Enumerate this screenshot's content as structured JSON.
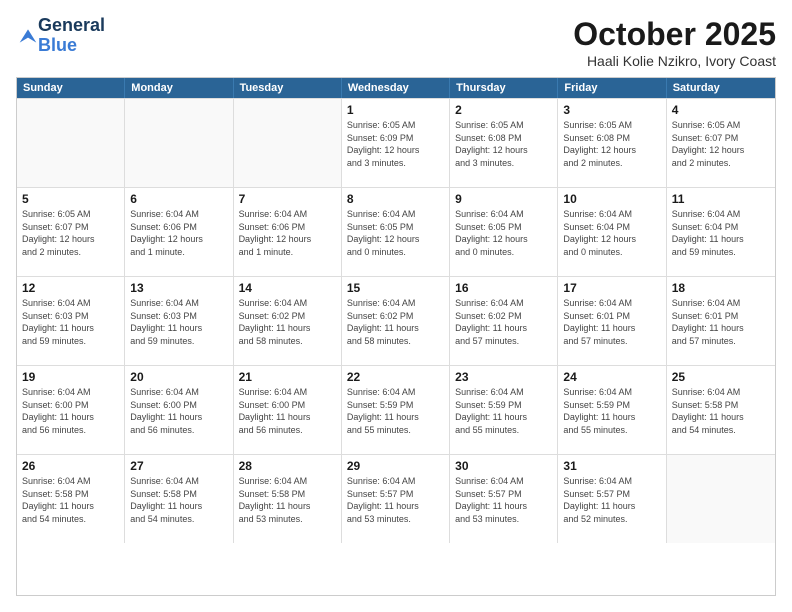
{
  "logo": {
    "line1": "General",
    "line2": "Blue"
  },
  "title": "October 2025",
  "location": "Haali Kolie Nzikro, Ivory Coast",
  "days_of_week": [
    "Sunday",
    "Monday",
    "Tuesday",
    "Wednesday",
    "Thursday",
    "Friday",
    "Saturday"
  ],
  "weeks": [
    [
      {
        "day": "",
        "info": ""
      },
      {
        "day": "",
        "info": ""
      },
      {
        "day": "",
        "info": ""
      },
      {
        "day": "1",
        "info": "Sunrise: 6:05 AM\nSunset: 6:09 PM\nDaylight: 12 hours\nand 3 minutes."
      },
      {
        "day": "2",
        "info": "Sunrise: 6:05 AM\nSunset: 6:08 PM\nDaylight: 12 hours\nand 3 minutes."
      },
      {
        "day": "3",
        "info": "Sunrise: 6:05 AM\nSunset: 6:08 PM\nDaylight: 12 hours\nand 2 minutes."
      },
      {
        "day": "4",
        "info": "Sunrise: 6:05 AM\nSunset: 6:07 PM\nDaylight: 12 hours\nand 2 minutes."
      }
    ],
    [
      {
        "day": "5",
        "info": "Sunrise: 6:05 AM\nSunset: 6:07 PM\nDaylight: 12 hours\nand 2 minutes."
      },
      {
        "day": "6",
        "info": "Sunrise: 6:04 AM\nSunset: 6:06 PM\nDaylight: 12 hours\nand 1 minute."
      },
      {
        "day": "7",
        "info": "Sunrise: 6:04 AM\nSunset: 6:06 PM\nDaylight: 12 hours\nand 1 minute."
      },
      {
        "day": "8",
        "info": "Sunrise: 6:04 AM\nSunset: 6:05 PM\nDaylight: 12 hours\nand 0 minutes."
      },
      {
        "day": "9",
        "info": "Sunrise: 6:04 AM\nSunset: 6:05 PM\nDaylight: 12 hours\nand 0 minutes."
      },
      {
        "day": "10",
        "info": "Sunrise: 6:04 AM\nSunset: 6:04 PM\nDaylight: 12 hours\nand 0 minutes."
      },
      {
        "day": "11",
        "info": "Sunrise: 6:04 AM\nSunset: 6:04 PM\nDaylight: 11 hours\nand 59 minutes."
      }
    ],
    [
      {
        "day": "12",
        "info": "Sunrise: 6:04 AM\nSunset: 6:03 PM\nDaylight: 11 hours\nand 59 minutes."
      },
      {
        "day": "13",
        "info": "Sunrise: 6:04 AM\nSunset: 6:03 PM\nDaylight: 11 hours\nand 59 minutes."
      },
      {
        "day": "14",
        "info": "Sunrise: 6:04 AM\nSunset: 6:02 PM\nDaylight: 11 hours\nand 58 minutes."
      },
      {
        "day": "15",
        "info": "Sunrise: 6:04 AM\nSunset: 6:02 PM\nDaylight: 11 hours\nand 58 minutes."
      },
      {
        "day": "16",
        "info": "Sunrise: 6:04 AM\nSunset: 6:02 PM\nDaylight: 11 hours\nand 57 minutes."
      },
      {
        "day": "17",
        "info": "Sunrise: 6:04 AM\nSunset: 6:01 PM\nDaylight: 11 hours\nand 57 minutes."
      },
      {
        "day": "18",
        "info": "Sunrise: 6:04 AM\nSunset: 6:01 PM\nDaylight: 11 hours\nand 57 minutes."
      }
    ],
    [
      {
        "day": "19",
        "info": "Sunrise: 6:04 AM\nSunset: 6:00 PM\nDaylight: 11 hours\nand 56 minutes."
      },
      {
        "day": "20",
        "info": "Sunrise: 6:04 AM\nSunset: 6:00 PM\nDaylight: 11 hours\nand 56 minutes."
      },
      {
        "day": "21",
        "info": "Sunrise: 6:04 AM\nSunset: 6:00 PM\nDaylight: 11 hours\nand 56 minutes."
      },
      {
        "day": "22",
        "info": "Sunrise: 6:04 AM\nSunset: 5:59 PM\nDaylight: 11 hours\nand 55 minutes."
      },
      {
        "day": "23",
        "info": "Sunrise: 6:04 AM\nSunset: 5:59 PM\nDaylight: 11 hours\nand 55 minutes."
      },
      {
        "day": "24",
        "info": "Sunrise: 6:04 AM\nSunset: 5:59 PM\nDaylight: 11 hours\nand 55 minutes."
      },
      {
        "day": "25",
        "info": "Sunrise: 6:04 AM\nSunset: 5:58 PM\nDaylight: 11 hours\nand 54 minutes."
      }
    ],
    [
      {
        "day": "26",
        "info": "Sunrise: 6:04 AM\nSunset: 5:58 PM\nDaylight: 11 hours\nand 54 minutes."
      },
      {
        "day": "27",
        "info": "Sunrise: 6:04 AM\nSunset: 5:58 PM\nDaylight: 11 hours\nand 54 minutes."
      },
      {
        "day": "28",
        "info": "Sunrise: 6:04 AM\nSunset: 5:58 PM\nDaylight: 11 hours\nand 53 minutes."
      },
      {
        "day": "29",
        "info": "Sunrise: 6:04 AM\nSunset: 5:57 PM\nDaylight: 11 hours\nand 53 minutes."
      },
      {
        "day": "30",
        "info": "Sunrise: 6:04 AM\nSunset: 5:57 PM\nDaylight: 11 hours\nand 53 minutes."
      },
      {
        "day": "31",
        "info": "Sunrise: 6:04 AM\nSunset: 5:57 PM\nDaylight: 11 hours\nand 52 minutes."
      },
      {
        "day": "",
        "info": ""
      }
    ]
  ]
}
